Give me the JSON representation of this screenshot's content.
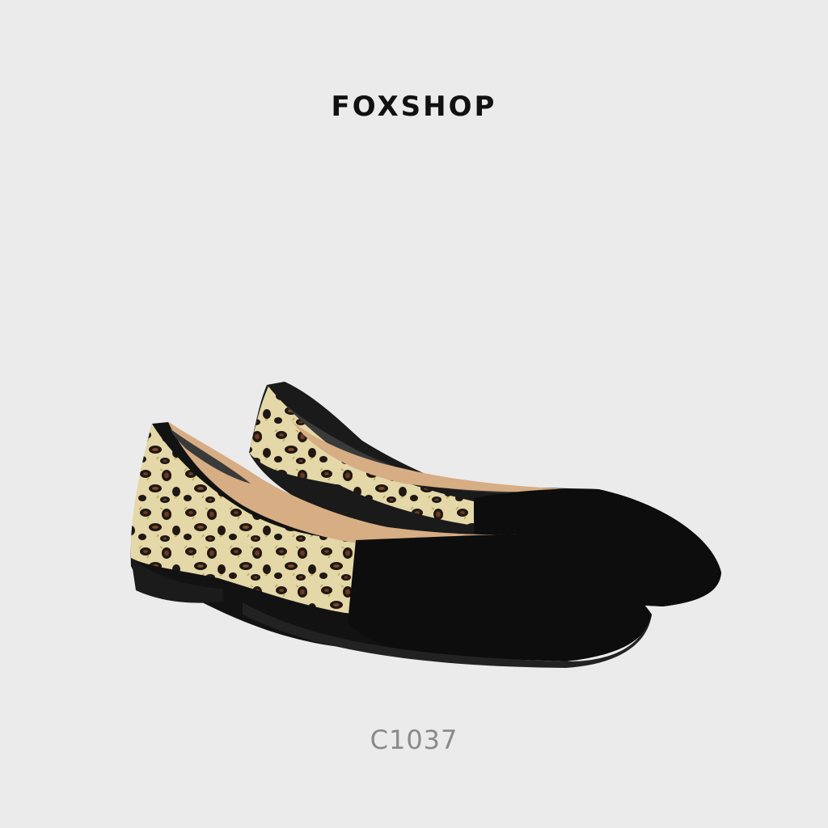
{
  "brand": {
    "name": "FOXSHOP"
  },
  "product": {
    "code": "C1037",
    "image": "leopard-print-pointed-flats-photo"
  },
  "colors": {
    "background": "#ebebeb",
    "brand_text": "#111111",
    "code_text": "#8a8a8a",
    "suede": "#0d0d0d",
    "leopard_base": "#e4d7a8",
    "leopard_spot": "#1f1712",
    "leopard_rosette": "#6b3a22",
    "lining": "#d7ad84"
  }
}
